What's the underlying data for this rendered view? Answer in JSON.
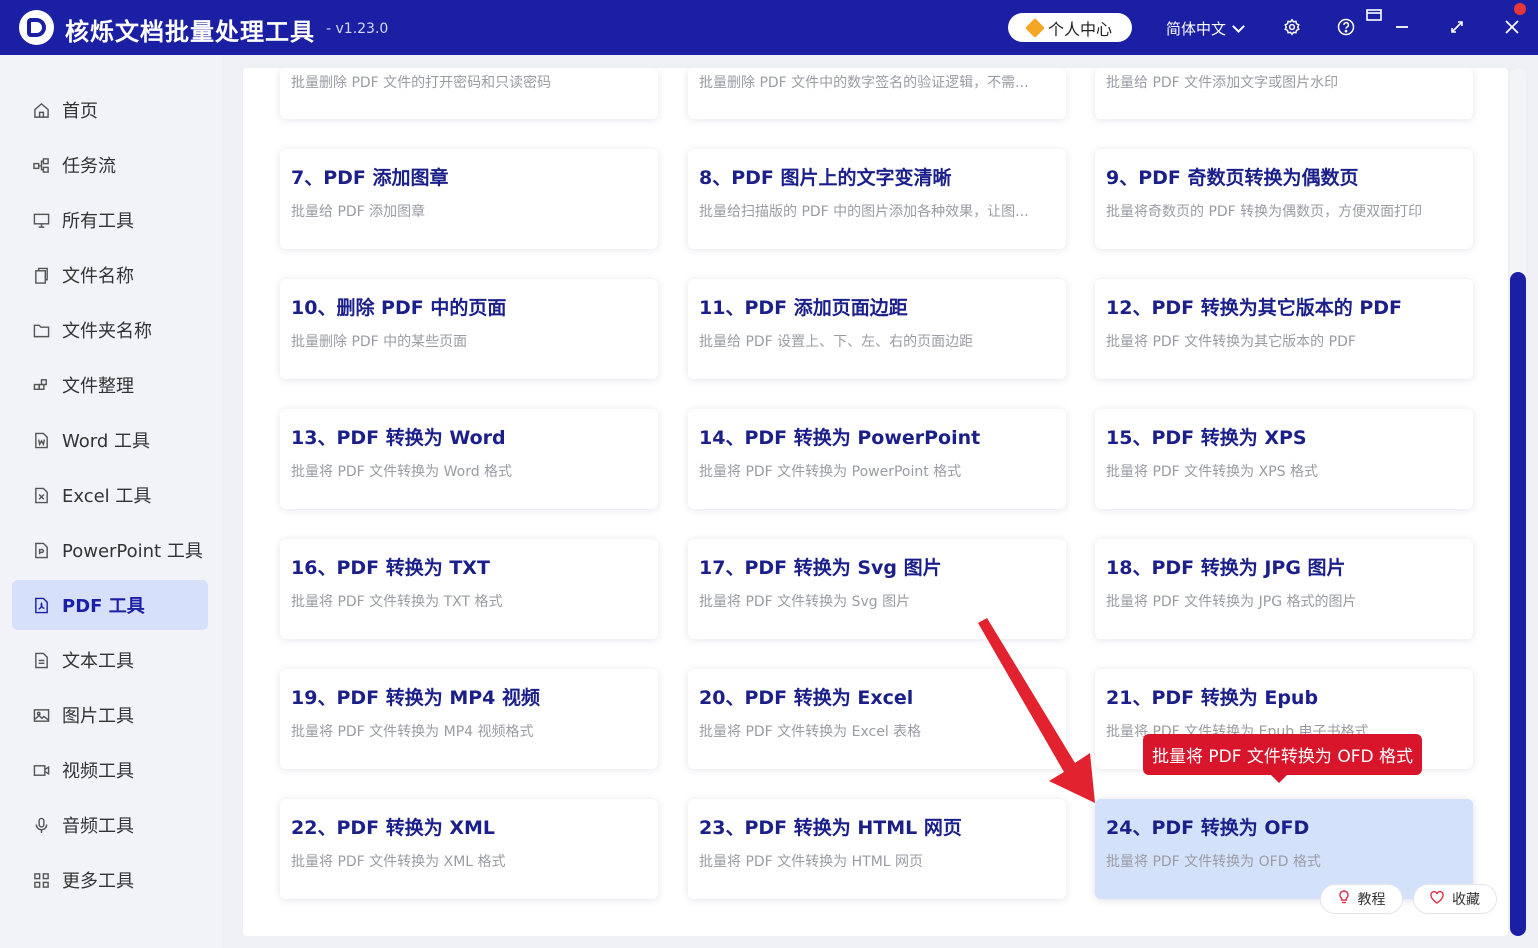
{
  "app": {
    "title": "核烁文档批量处理工具",
    "version": "- v1.23.0",
    "user_center": "个人中心",
    "language": "简体中文"
  },
  "sidebar": {
    "items": [
      {
        "label": "首页",
        "icon": "home-icon"
      },
      {
        "label": "任务流",
        "icon": "workflow-icon"
      },
      {
        "label": "所有工具",
        "icon": "monitor-icon"
      },
      {
        "label": "文件名称",
        "icon": "file-copy-icon"
      },
      {
        "label": "文件夹名称",
        "icon": "folder-icon"
      },
      {
        "label": "文件整理",
        "icon": "organize-icon"
      },
      {
        "label": "Word 工具",
        "icon": "word-file-icon"
      },
      {
        "label": "Excel 工具",
        "icon": "excel-file-icon"
      },
      {
        "label": "PowerPoint 工具",
        "icon": "ppt-file-icon"
      },
      {
        "label": "PDF 工具",
        "icon": "pdf-file-icon",
        "active": true
      },
      {
        "label": "文本工具",
        "icon": "text-file-icon"
      },
      {
        "label": "图片工具",
        "icon": "image-icon"
      },
      {
        "label": "视频工具",
        "icon": "video-icon"
      },
      {
        "label": "音频工具",
        "icon": "microphone-icon"
      },
      {
        "label": "更多工具",
        "icon": "grid-icon"
      }
    ]
  },
  "cards_top": [
    {
      "desc": "批量删除 PDF 文件的打开密码和只读密码"
    },
    {
      "desc": "批量删除 PDF 文件中的数字签名的验证逻辑，不需..."
    },
    {
      "desc": "批量给 PDF 文件添加文字或图片水印"
    }
  ],
  "cards": [
    {
      "title": "7、PDF 添加图章",
      "desc": "批量给 PDF 添加图章"
    },
    {
      "title": "8、PDF 图片上的文字变清晰",
      "desc": "批量给扫描版的 PDF 中的图片添加各种效果，让图..."
    },
    {
      "title": "9、PDF 奇数页转换为偶数页",
      "desc": "批量将奇数页的 PDF 转换为偶数页，方便双面打印"
    },
    {
      "title": "10、删除 PDF 中的页面",
      "desc": "批量删除 PDF 中的某些页面"
    },
    {
      "title": "11、PDF 添加页面边距",
      "desc": "批量给 PDF 设置上、下、左、右的页面边距"
    },
    {
      "title": "12、PDF 转换为其它版本的 PDF",
      "desc": "批量将 PDF 文件转换为其它版本的 PDF"
    },
    {
      "title": "13、PDF 转换为 Word",
      "desc": "批量将 PDF 文件转换为 Word 格式"
    },
    {
      "title": "14、PDF 转换为 PowerPoint",
      "desc": "批量将 PDF 文件转换为 PowerPoint 格式"
    },
    {
      "title": "15、PDF 转换为 XPS",
      "desc": "批量将 PDF 文件转换为 XPS 格式"
    },
    {
      "title": "16、PDF 转换为 TXT",
      "desc": "批量将 PDF 文件转换为 TXT 格式"
    },
    {
      "title": "17、PDF 转换为 Svg 图片",
      "desc": "批量将 PDF 文件转换为 Svg 图片"
    },
    {
      "title": "18、PDF 转换为 JPG 图片",
      "desc": "批量将 PDF 文件转换为 JPG 格式的图片"
    },
    {
      "title": "19、PDF 转换为 MP4 视频",
      "desc": "批量将 PDF 文件转换为 MP4 视频格式"
    },
    {
      "title": "20、PDF 转换为 Excel",
      "desc": "批量将 PDF 文件转换为 Excel 表格"
    },
    {
      "title": "21、PDF 转换为 Epub",
      "desc": "批量将 PDF 文件转换为 Epub 电子书格式"
    },
    {
      "title": "22、PDF 转换为 XML",
      "desc": "批量将 PDF 文件转换为 XML 格式"
    },
    {
      "title": "23、PDF 转换为 HTML 网页",
      "desc": "批量将 PDF 文件转换为 HTML 网页"
    },
    {
      "title": "24、PDF 转换为 OFD",
      "desc": "批量将 PDF 文件转换为 OFD 格式",
      "selected": true
    }
  ],
  "tooltip": "批量将 PDF 文件转换为 OFD 格式",
  "card_actions": {
    "tutorial": "教程",
    "favorite": "收藏"
  },
  "colors": {
    "brand": "#1b1fa3",
    "card_title": "#1b1f8a",
    "tooltip_bg": "#d8152b",
    "selected_card": "#d4e1fb",
    "arrow": "#e3222f"
  }
}
